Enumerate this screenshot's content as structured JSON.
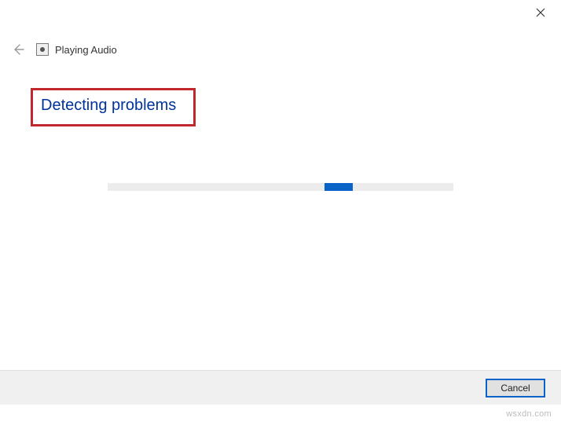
{
  "window": {
    "title": "Playing Audio"
  },
  "content": {
    "heading": "Detecting problems"
  },
  "footer": {
    "cancel_label": "Cancel"
  },
  "watermark": "wsxdn.com"
}
